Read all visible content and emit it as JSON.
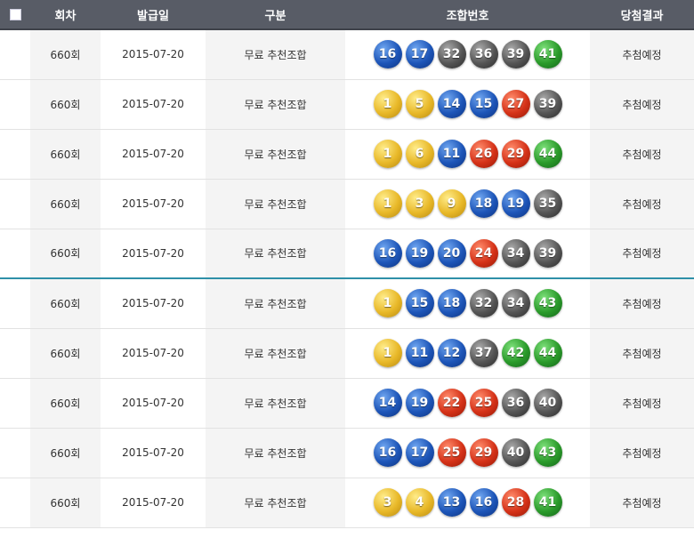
{
  "header": {
    "round": "회차",
    "date": "발급일",
    "type": "구분",
    "numbers": "조합번호",
    "result": "당첨결과"
  },
  "rows": [
    {
      "round": "660회",
      "date": "2015-07-20",
      "type": "무료 추천조합",
      "numbers": [
        "16",
        "17",
        "32",
        "36",
        "39",
        "41"
      ],
      "result": "추첨예정"
    },
    {
      "round": "660회",
      "date": "2015-07-20",
      "type": "무료 추천조합",
      "numbers": [
        "1",
        "5",
        "14",
        "15",
        "27",
        "39"
      ],
      "result": "추첨예정"
    },
    {
      "round": "660회",
      "date": "2015-07-20",
      "type": "무료 추천조합",
      "numbers": [
        "1",
        "6",
        "11",
        "26",
        "29",
        "44"
      ],
      "result": "추첨예정"
    },
    {
      "round": "660회",
      "date": "2015-07-20",
      "type": "무료 추천조합",
      "numbers": [
        "1",
        "3",
        "9",
        "18",
        "19",
        "35"
      ],
      "result": "추첨예정"
    },
    {
      "round": "660회",
      "date": "2015-07-20",
      "type": "무료 추천조합",
      "numbers": [
        "16",
        "19",
        "20",
        "24",
        "34",
        "39"
      ],
      "result": "추첨예정"
    },
    {
      "round": "660회",
      "date": "2015-07-20",
      "type": "무료 추천조합",
      "numbers": [
        "1",
        "15",
        "18",
        "32",
        "34",
        "43"
      ],
      "result": "추첨예정"
    },
    {
      "round": "660회",
      "date": "2015-07-20",
      "type": "무료 추천조합",
      "numbers": [
        "1",
        "11",
        "12",
        "37",
        "42",
        "44"
      ],
      "result": "추첨예정"
    },
    {
      "round": "660회",
      "date": "2015-07-20",
      "type": "무료 추천조합",
      "numbers": [
        "14",
        "19",
        "22",
        "25",
        "36",
        "40"
      ],
      "result": "추첨예정"
    },
    {
      "round": "660회",
      "date": "2015-07-20",
      "type": "무료 추천조합",
      "numbers": [
        "16",
        "17",
        "25",
        "29",
        "40",
        "43"
      ],
      "result": "추첨예정"
    },
    {
      "round": "660회",
      "date": "2015-07-20",
      "type": "무료 추천조합",
      "numbers": [
        "3",
        "4",
        "13",
        "16",
        "28",
        "41"
      ],
      "result": "추첨예정"
    }
  ],
  "ball_colors": {
    "1-10": "#e8b828",
    "11-20": "#1d55b8",
    "21-30": "#d53218",
    "31-40": "#555555",
    "41-45": "#2a9a2a"
  }
}
